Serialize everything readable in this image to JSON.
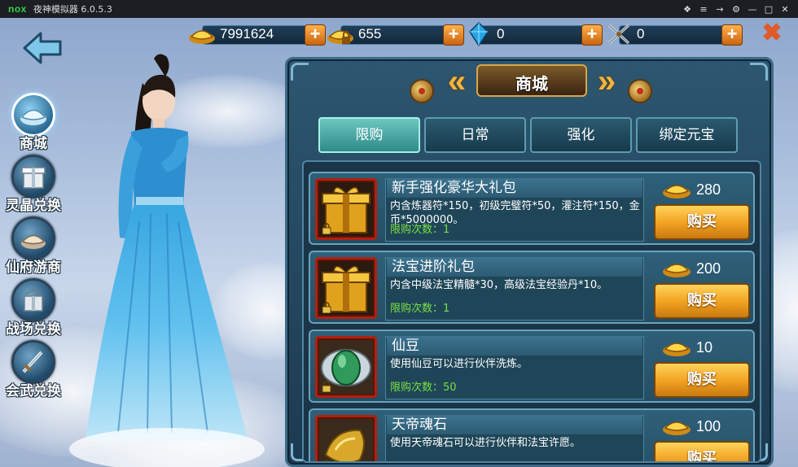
{
  "app": {
    "logo": "nox",
    "title": "夜神模拟器 6.0.5.3",
    "controls": [
      "❖",
      "≡",
      "→",
      "⚙",
      "—",
      "□",
      "✕"
    ]
  },
  "currencies": [
    {
      "icon": "gold-ingot-icon",
      "value": "7991624"
    },
    {
      "icon": "locked-gold-ingot-icon",
      "value": "655"
    },
    {
      "icon": "blue-crystal-icon",
      "value": "0"
    },
    {
      "icon": "crossed-swords-icon",
      "value": "0"
    }
  ],
  "plus_label": "+",
  "close_label": "✖",
  "nav": [
    {
      "label": "商城",
      "icon": "silver-ingot-icon",
      "active": true
    },
    {
      "label": "灵晶兑换",
      "icon": "gift-box-icon",
      "active": false
    },
    {
      "label": "仙府游商",
      "icon": "merchant-ingot-icon",
      "active": false
    },
    {
      "label": "战场兑换",
      "icon": "battle-gift-icon",
      "active": false
    },
    {
      "label": "会武兑换",
      "icon": "sword-icon",
      "active": false
    }
  ],
  "panel": {
    "title": "商城",
    "chevron_left": "«",
    "chevron_right": "»",
    "tabs": [
      {
        "label": "限购",
        "active": true
      },
      {
        "label": "日常",
        "active": false
      },
      {
        "label": "强化",
        "active": false
      },
      {
        "label": "绑定元宝",
        "active": false
      }
    ]
  },
  "items": [
    {
      "name": "新手强化豪华大礼包",
      "desc": "内含炼器符*150，初级完璧符*50，灌注符*150，金币*5000000。",
      "limit": "限购次数：1",
      "price": "280",
      "buy": "购买",
      "icon": "gold-gift-box-icon"
    },
    {
      "name": "法宝进阶礼包",
      "desc": "内含中级法宝精髓*30，高级法宝经验丹*10。",
      "limit": "限购次数：1",
      "price": "200",
      "buy": "购买",
      "icon": "gold-gift-box-icon"
    },
    {
      "name": "仙豆",
      "desc": "使用仙豆可以进行伙伴洗炼。",
      "limit": "限购次数：50",
      "price": "10",
      "buy": "购买",
      "icon": "green-bean-icon"
    },
    {
      "name": "天帝魂石",
      "desc": "使用天帝魂石可以进行伙伴和法宝许愿。",
      "limit": "",
      "price": "100",
      "buy": "购买",
      "icon": "soul-stone-icon"
    }
  ],
  "colors": {
    "accent_gold": "#f2b63b",
    "panel_bg": "#1c3a50",
    "limit_green": "#79e042",
    "buy_orange": "#f0a020",
    "thumb_border": "#b1200f"
  }
}
